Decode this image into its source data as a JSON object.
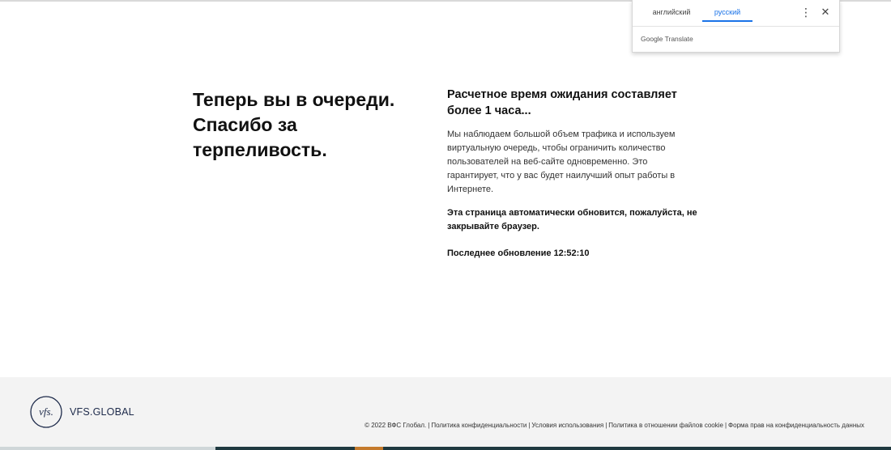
{
  "translate_popup": {
    "tab_source": "английский",
    "tab_target": "русский",
    "brand": "Google Translate",
    "more_icon": "vertical-dots-icon",
    "close_icon": "close-icon",
    "accent_color": "#1a73e8"
  },
  "main": {
    "headline": "Теперь вы в очереди. Спасибо за терпеливость.",
    "wait_title": "Расчетное время ожидания составляет более 1 часа...",
    "body": "Мы наблюдаем большой объем трафика и используем виртуальную очередь, чтобы ограничить количество пользователей на веб-сайте одновременно. Это гарантирует, что у вас будет наилучший опыт работы в Интернете.",
    "notice": "Эта страница автоматически обновится, пожалуйста, не закрывайте браузер.",
    "last_update": "Последнее обновление 12:52:10"
  },
  "footer": {
    "logo_text": "vfs.",
    "brand": "VFS.GLOBAL",
    "copyright": "© 2022 ВФС Глобал.",
    "links": [
      "Политика конфиденциальности",
      "Условия использования",
      "Политика в отношении файлов cookie",
      "Форма прав на конфиденциальность данных"
    ]
  }
}
